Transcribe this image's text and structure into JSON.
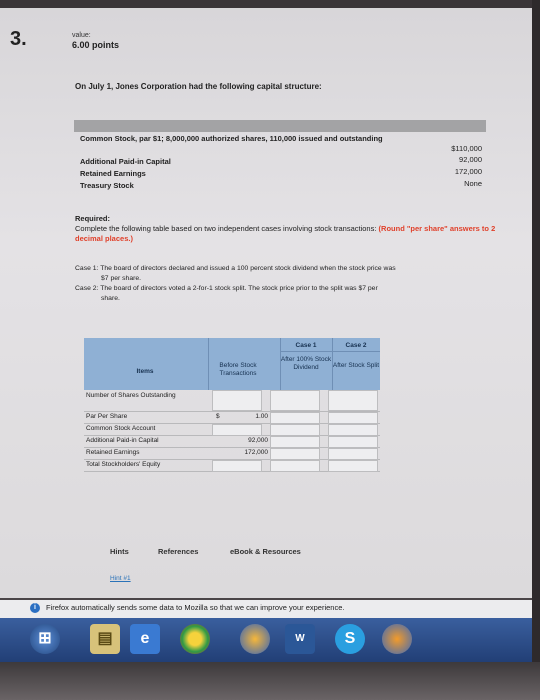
{
  "question": {
    "number": "3.",
    "value_label": "value:",
    "points": "6.00 points"
  },
  "intro": "On July 1, Jones Corporation had the following capital structure:",
  "capital_structure": [
    {
      "label": "Common Stock, par $1; 8,000,000 authorized shares, 110,000 issued and outstanding",
      "value": "$110,000"
    },
    {
      "label": "Additional Paid-in Capital",
      "value": "92,000"
    },
    {
      "label": "Retained Earnings",
      "value": "172,000"
    },
    {
      "label": "Treasury Stock",
      "value": "None"
    }
  ],
  "required": {
    "heading": "Required:",
    "text": "Complete the following table based on two independent cases involving stock transactions:",
    "round_note": "(Round \"per share\" answers to 2 decimal places.)"
  },
  "cases": {
    "case1": "Case 1: The board of directors declared and issued a 100 percent stock dividend when the stock price was",
    "case1_cont": "$7 per share.",
    "case2": "Case 2: The board of directors voted a 2-for-1 stock split. The stock price prior to the split was $7 per",
    "case2_cont": "share."
  },
  "table": {
    "headers": {
      "items": "Items",
      "before": "Before Stock Transactions",
      "case1": "Case 1",
      "case1_sub": "After 100% Stock Dividend",
      "case2": "Case 2",
      "case2_sub": "After Stock Split"
    },
    "rows": [
      {
        "label": "Number of Shares Outstanding",
        "symbol": "",
        "before": ""
      },
      {
        "label": "Par Per Share",
        "symbol": "$",
        "before": "1.00"
      },
      {
        "label": "Common Stock Account",
        "symbol": "",
        "before": ""
      },
      {
        "label": "Additional Paid-in Capital",
        "symbol": "",
        "before": "92,000"
      },
      {
        "label": "Retained Earnings",
        "symbol": "",
        "before": "172,000"
      },
      {
        "label": "Total Stockholders' Equity",
        "symbol": "",
        "before": ""
      }
    ]
  },
  "tabs": {
    "hints": "Hints",
    "references": "References",
    "ebook": "eBook & Resources"
  },
  "hint_link": "Hint #1",
  "firefox_notice": "Firefox automatically sends some data to Mozilla so that we can improve your experience.",
  "taskbar": {
    "word_label": "W",
    "skype_label": "S"
  }
}
